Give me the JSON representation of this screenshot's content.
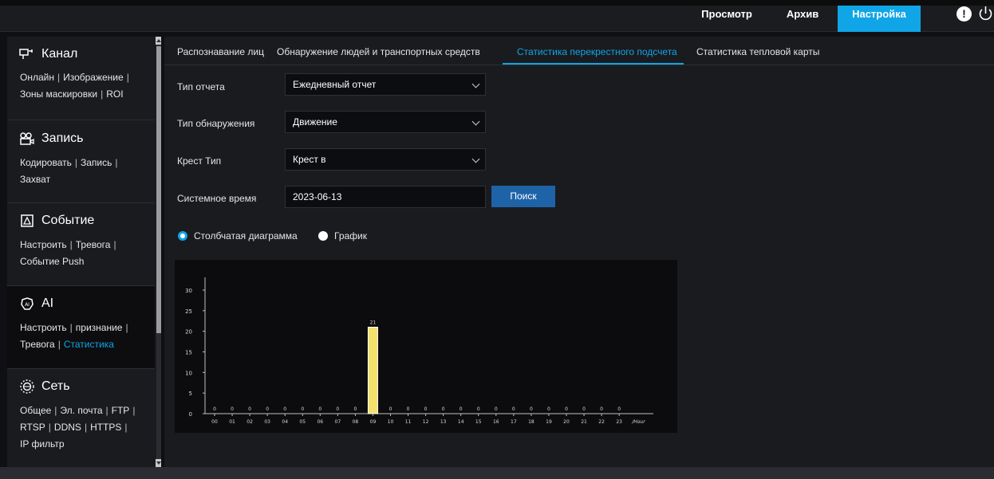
{
  "header": {
    "nav": [
      "Просмотр",
      "Архив",
      "Настройка"
    ],
    "active_nav": "Настройка"
  },
  "sidebar": {
    "sections": [
      {
        "title": "Канал",
        "icon": "channel-icon",
        "links": [
          [
            "Онлайн",
            "Изображение"
          ],
          [
            "Зоны маскировки",
            "ROI"
          ]
        ]
      },
      {
        "title": "Запись",
        "icon": "record-icon",
        "links": [
          [
            "Кодировать",
            "Запись"
          ],
          [
            "Захват"
          ]
        ]
      },
      {
        "title": "Событие",
        "icon": "event-icon",
        "links": [
          [
            "Настроить",
            "Тревога"
          ],
          [
            "Событие Push"
          ]
        ]
      },
      {
        "title": "AI",
        "icon": "ai-icon",
        "links": [
          [
            "Настроить",
            "признание"
          ],
          [
            "Тревога",
            "Статистика"
          ]
        ]
      },
      {
        "title": "Сеть",
        "icon": "network-icon",
        "links": [
          [
            "Общее",
            "Эл. почта",
            "FTP"
          ],
          [
            "RTSP",
            "DDNS",
            "HTTPS"
          ],
          [
            "IP фильтр"
          ]
        ]
      }
    ],
    "active_link": "Статистика"
  },
  "tabs": [
    "Распознавание лиц",
    "Обнаружение людей и транспортных средств",
    "Статистика перекрестного подсчета",
    "Статистика тепловой карты"
  ],
  "active_tab": 2,
  "form": {
    "report_type_label": "Тип отчета",
    "report_type_value": "Ежедневный отчет",
    "detection_type_label": "Тип обнаружения",
    "detection_type_value": "Движение",
    "cross_type_label": "Крест Тип",
    "cross_type_value": "Крест в",
    "system_time_label": "Системное время",
    "system_time_value": "2023-06-13",
    "search_label": "Поиск"
  },
  "view_mode": {
    "bar_label": "Столбчатая диаграмма",
    "line_label": "График",
    "selected": "bar"
  },
  "colors": {
    "accent": "#10a5e6",
    "bar": "#f5e06a"
  },
  "chart_data": {
    "type": "bar",
    "categories": [
      "00",
      "01",
      "02",
      "03",
      "04",
      "05",
      "06",
      "07",
      "08",
      "09",
      "10",
      "11",
      "12",
      "13",
      "14",
      "15",
      "16",
      "17",
      "18",
      "19",
      "20",
      "21",
      "22",
      "23"
    ],
    "values": [
      0,
      0,
      0,
      0,
      0,
      0,
      0,
      0,
      0,
      21,
      0,
      0,
      0,
      0,
      0,
      0,
      0,
      0,
      0,
      0,
      0,
      0,
      0,
      0
    ],
    "data_labels": {
      "9": "21"
    },
    "xlabel": "/Hour",
    "ylabel": "",
    "yticks": [
      0,
      5,
      10,
      15,
      20,
      25,
      30
    ],
    "ylim": [
      0,
      30
    ]
  }
}
